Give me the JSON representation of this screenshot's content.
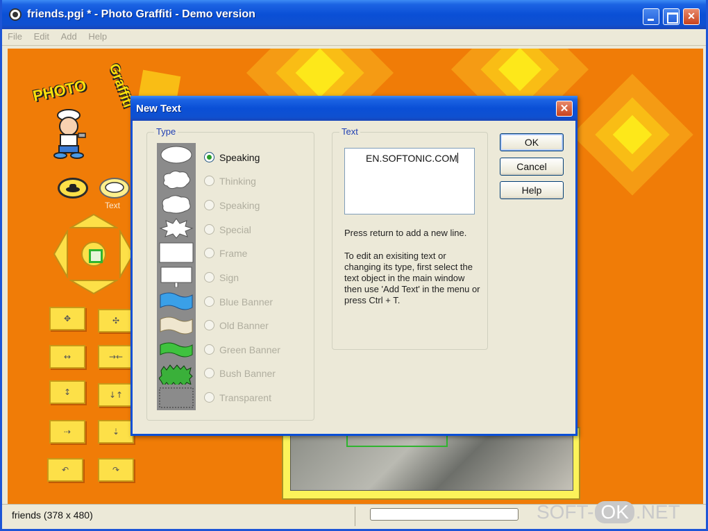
{
  "window": {
    "title": "friends.pgi * - Photo Graffiti  -  Demo version",
    "menu": [
      "File",
      "Edit",
      "Add",
      "Help"
    ]
  },
  "toolbox": {
    "logo_words": [
      "PHOTO",
      "Graffiti"
    ],
    "text_tool_label": "Text"
  },
  "dialog": {
    "title": "New Text",
    "type_group_label": "Type",
    "types": [
      {
        "label": "Speaking",
        "selected": true,
        "enabled": true
      },
      {
        "label": "Thinking",
        "selected": false,
        "enabled": false
      },
      {
        "label": "Speaking",
        "selected": false,
        "enabled": false
      },
      {
        "label": "Special",
        "selected": false,
        "enabled": false
      },
      {
        "label": "Frame",
        "selected": false,
        "enabled": false
      },
      {
        "label": "Sign",
        "selected": false,
        "enabled": false
      },
      {
        "label": "Blue Banner",
        "selected": false,
        "enabled": false
      },
      {
        "label": "Old Banner",
        "selected": false,
        "enabled": false
      },
      {
        "label": "Green Banner",
        "selected": false,
        "enabled": false
      },
      {
        "label": "Bush Banner",
        "selected": false,
        "enabled": false
      },
      {
        "label": "Transparent",
        "selected": false,
        "enabled": false
      }
    ],
    "text_group_label": "Text",
    "text_value": "EN.SOFTONIC.COM",
    "hint_newline": "Press return to add a new line.",
    "hint_edit": "To edit an exisiting text or changing its type, first select the text object in the main window then use 'Add Text' in the menu or press Ctrl + T.",
    "ok_label": "OK",
    "cancel_label": "Cancel",
    "help_label": "Help",
    "close_glyph": "✕"
  },
  "status": {
    "text": "friends (378 x 480)"
  },
  "watermark": {
    "left": "SOFT-",
    "middle": "OK",
    "right": ".NET"
  },
  "colors": {
    "canvas": "#f07c07",
    "title_blue": "#0a4fd6",
    "accent_yellow": "#fde048"
  }
}
